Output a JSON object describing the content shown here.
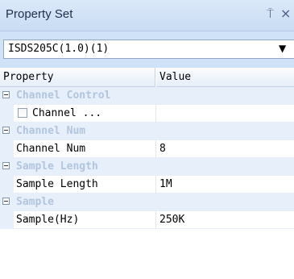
{
  "panel": {
    "title": "Property Set",
    "pin_glyph": "⍑",
    "close_glyph": "×"
  },
  "selector": {
    "value": "ISDS205C(1.0)(1)",
    "arrow_glyph": "▼"
  },
  "grid": {
    "headers": {
      "property": "Property",
      "value": "Value"
    },
    "categories": [
      {
        "label": "Channel Control",
        "rows": [
          {
            "name": "Channel ...",
            "value": "",
            "checkbox": true,
            "checked": false
          }
        ]
      },
      {
        "label": "Channel Num",
        "rows": [
          {
            "name": "Channel Num",
            "value": "8"
          }
        ]
      },
      {
        "label": "Sample Length",
        "rows": [
          {
            "name": "Sample Length",
            "value": "1M"
          }
        ]
      },
      {
        "label": "Sample",
        "rows": [
          {
            "name": "Sample(Hz)",
            "value": "250K"
          }
        ]
      }
    ]
  },
  "colors": {
    "panel_background": "#cfe2f7",
    "category_text": "#b2c5de",
    "category_background": "#e7effa"
  }
}
